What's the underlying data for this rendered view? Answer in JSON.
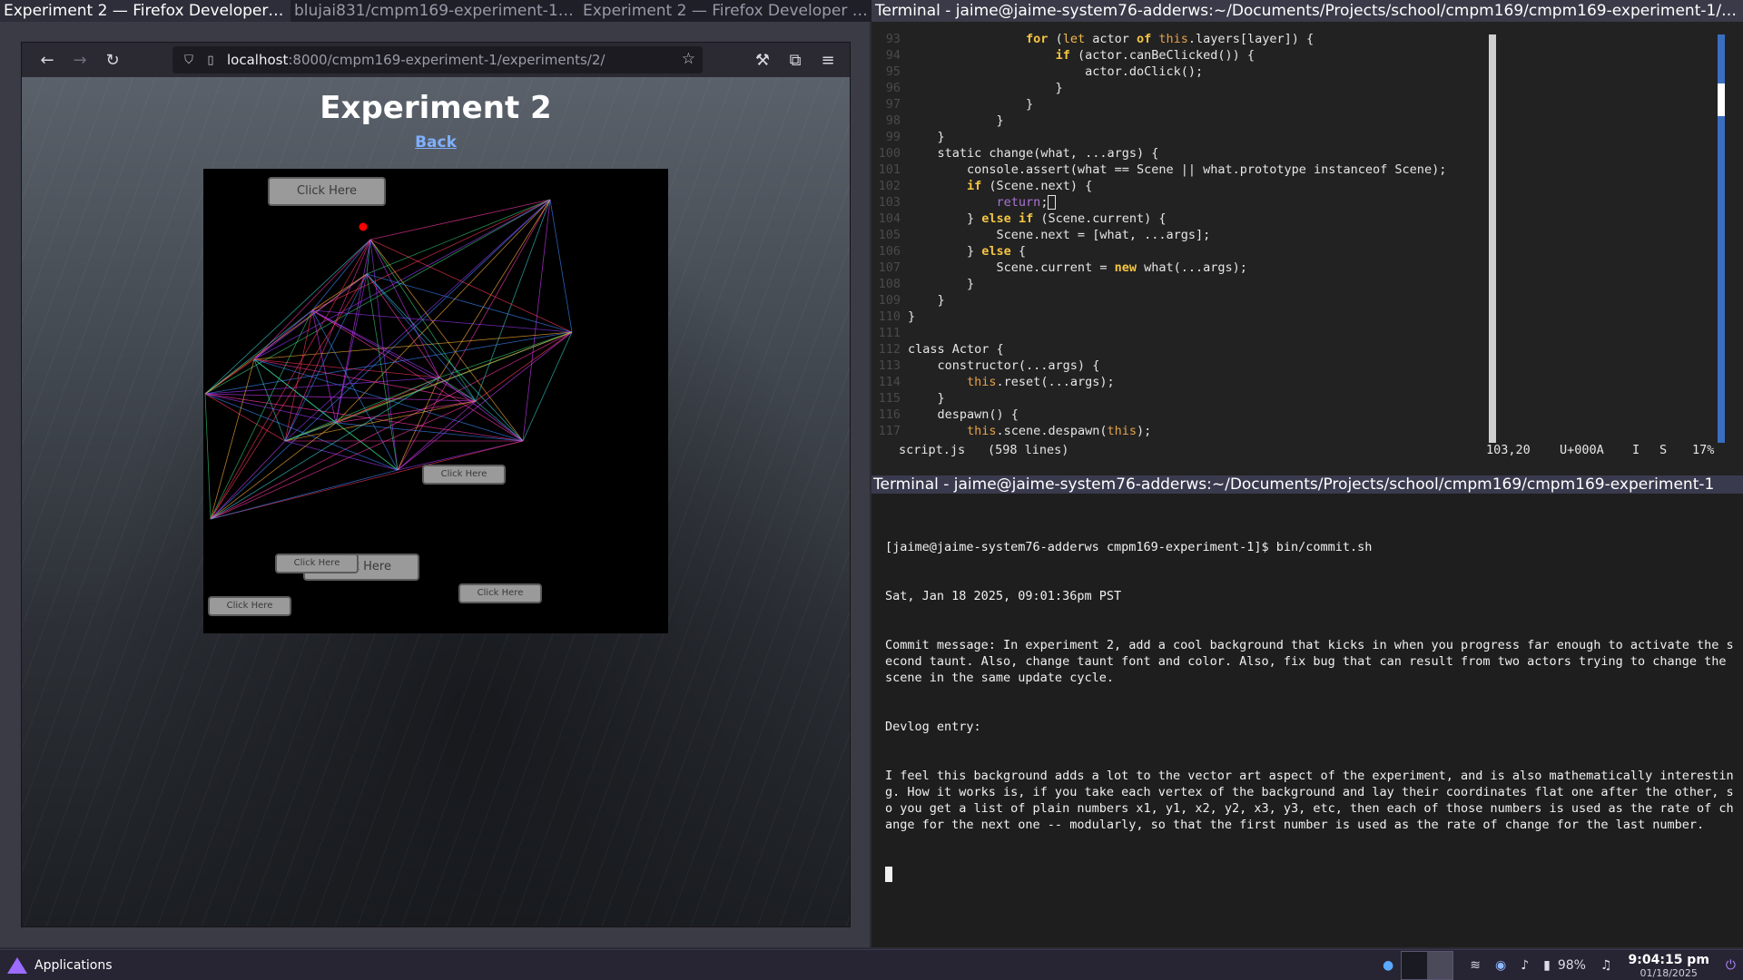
{
  "window_titles": [
    "Experiment 2 — Firefox Developer Ed...",
    "blujai831/cmpm169-experiment-1: T...",
    "Experiment 2 — Firefox Developer Ed...",
    "Terminal - jaime@jaime-system76-adderws:~/Documents/Projects/school/cmpm169/cmpm169-experiment-1/experim..."
  ],
  "browser": {
    "url_host": "localhost",
    "url_rest": ":8000/cmpm169-experiment-1/experiments/2/",
    "nav": {
      "back": "←",
      "forward": "→",
      "reload": "↻"
    },
    "icons": {
      "shield": "⛉",
      "page": "▯",
      "star": "☆",
      "wrench": "⚒",
      "extensions": "⧉",
      "menu": "≡"
    }
  },
  "page": {
    "title": "Experiment 2",
    "back_link": "Back",
    "buttons": [
      "Click Here",
      "Click Here",
      "Click Here",
      "Click Here",
      "Click Here",
      "Click Here"
    ],
    "red_dot_color": "#ff0000",
    "canvas_background": "#000000"
  },
  "editor": {
    "code_lines": [
      {
        "n": "93",
        "t": "        for (let actor of this.layers[layer]) {"
      },
      {
        "n": "94",
        "t": "            if (actor.canBeClicked()) {"
      },
      {
        "n": "95",
        "t": "                actor.doClick();"
      },
      {
        "n": "96",
        "t": "            }"
      },
      {
        "n": "97",
        "t": "        }"
      },
      {
        "n": "98",
        "t": "    }"
      },
      {
        "n": "99",
        "t": "}"
      },
      {
        "n": "100",
        "t": "static change(what, ...args) {"
      },
      {
        "n": "101",
        "t": "    console.assert(what == Scene || what.prototype instanceof Scene);"
      },
      {
        "n": "102",
        "t": "    if (Scene.next) {"
      },
      {
        "n": "103",
        "t": "        return;"
      },
      {
        "n": "104",
        "t": "    } else if (Scene.current) {"
      },
      {
        "n": "105",
        "t": "        Scene.next = [what, ...args];"
      },
      {
        "n": "106",
        "t": "    } else {"
      },
      {
        "n": "107",
        "t": "        Scene.current = new what(...args);"
      },
      {
        "n": "108",
        "t": "    }"
      },
      {
        "n": "109",
        "t": "}"
      },
      {
        "n": "110",
        "t": "}"
      },
      {
        "n": "111",
        "t": ""
      },
      {
        "n": "112",
        "t": "class Actor {"
      },
      {
        "n": "113",
        "t": "    constructor(...args) {"
      },
      {
        "n": "114",
        "t": "        this.reset(...args);"
      },
      {
        "n": "115",
        "t": "    }"
      },
      {
        "n": "116",
        "t": "    despawn() {"
      },
      {
        "n": "117",
        "t": "        this.scene.despawn(this);"
      }
    ],
    "status": {
      "filename": "script.js",
      "lines": "(598 lines)",
      "position": "103,20",
      "codepoint": "U+000A",
      "mode_i": "I",
      "mode_s": "S",
      "percent": "17%"
    }
  },
  "terminal2": {
    "title": "Terminal - jaime@jaime-system76-adderws:~/Documents/Projects/school/cmpm169/cmpm169-experiment-1",
    "prompt": "[jaime@jaime-system76-adderws cmpm169-experiment-1]$ bin/commit.sh",
    "date": "Sat, Jan 18 2025, 09:01:36pm PST",
    "commit_message": "Commit message: In experiment 2, add a cool background that kicks in when you progress far enough to activate the second taunt. Also, change taunt font and color. Also, fix bug that can result from two actors trying to change the scene in the same update cycle.",
    "devlog_label": "Devlog entry:",
    "devlog": "I feel this background adds a lot to the vector art aspect of the experiment, and is also mathematically interesting. How it works is, if you take each vertex of the background and lay their coordinates flat one after the other, so you get a list of plain numbers x1, y1, x2, y2, x3, y3, etc, then each of those numbers is used as the rate of change for the next one -- modularly, so that the first number is used as the rate of change for the last number."
  },
  "taskbar": {
    "applications": "Applications",
    "battery": "98%",
    "time": "9:04:15 pm",
    "date": "01/18/2025",
    "icons": {
      "firefox": "●",
      "wifi": "≋",
      "steam": "◉",
      "volume": "♪",
      "battery": "▮",
      "bell": "♫",
      "power": "⏻"
    }
  }
}
